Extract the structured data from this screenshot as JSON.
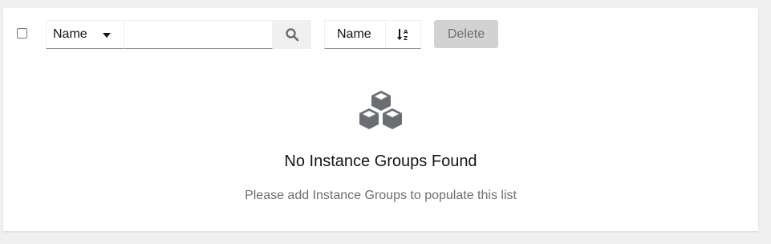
{
  "toolbar": {
    "filter_type_label": "Name",
    "search_placeholder": "",
    "sort_label": "Name",
    "delete_label": "Delete"
  },
  "empty_state": {
    "title": "No Instance Groups Found",
    "body": "Please add Instance Groups to populate this list",
    "icon": "cubes-icon"
  },
  "colors": {
    "background": "#f0f0f0",
    "card": "#ffffff",
    "icon_gray": "#6a6e73",
    "disabled_button": "#d2d2d2"
  }
}
